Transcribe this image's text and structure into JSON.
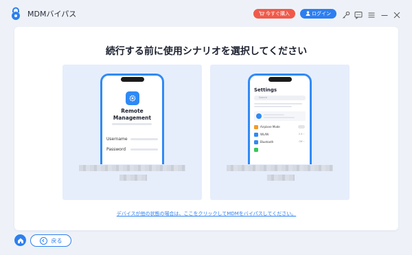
{
  "app": {
    "title": "MDMバイパス",
    "logo_icon": "lock-logo-icon"
  },
  "titlebar": {
    "buy_label": "今すぐ購入",
    "login_label": "ログイン",
    "icons": [
      "cart-icon",
      "user-icon",
      "key-icon",
      "feedback-icon",
      "menu-icon",
      "minimize-icon",
      "close-icon"
    ]
  },
  "main": {
    "heading": "続行する前に使用シナリオを選択してください",
    "card_left": {
      "phone_title": "Remote Management",
      "username_label": "Username",
      "password_label": "Password"
    },
    "card_right": {
      "settings_title": "Settings",
      "search_placeholder": "Search",
      "rows": [
        {
          "label": "Airplane Mode",
          "value": ""
        },
        {
          "label": "WLAN",
          "value": "2.4 ›"
        },
        {
          "label": "Bluetooth",
          "value": "Off ›"
        }
      ]
    },
    "link_text": "デバイスが他の状態の場合は、ここをクリックしてMDMをバイパスしてください。"
  },
  "footer": {
    "back_label": "戻る"
  },
  "colors": {
    "accent": "#2d7ff0",
    "buy": "#f05a4a",
    "card_bg": "#e6eefc",
    "phone_frame": "#2f8af5"
  }
}
